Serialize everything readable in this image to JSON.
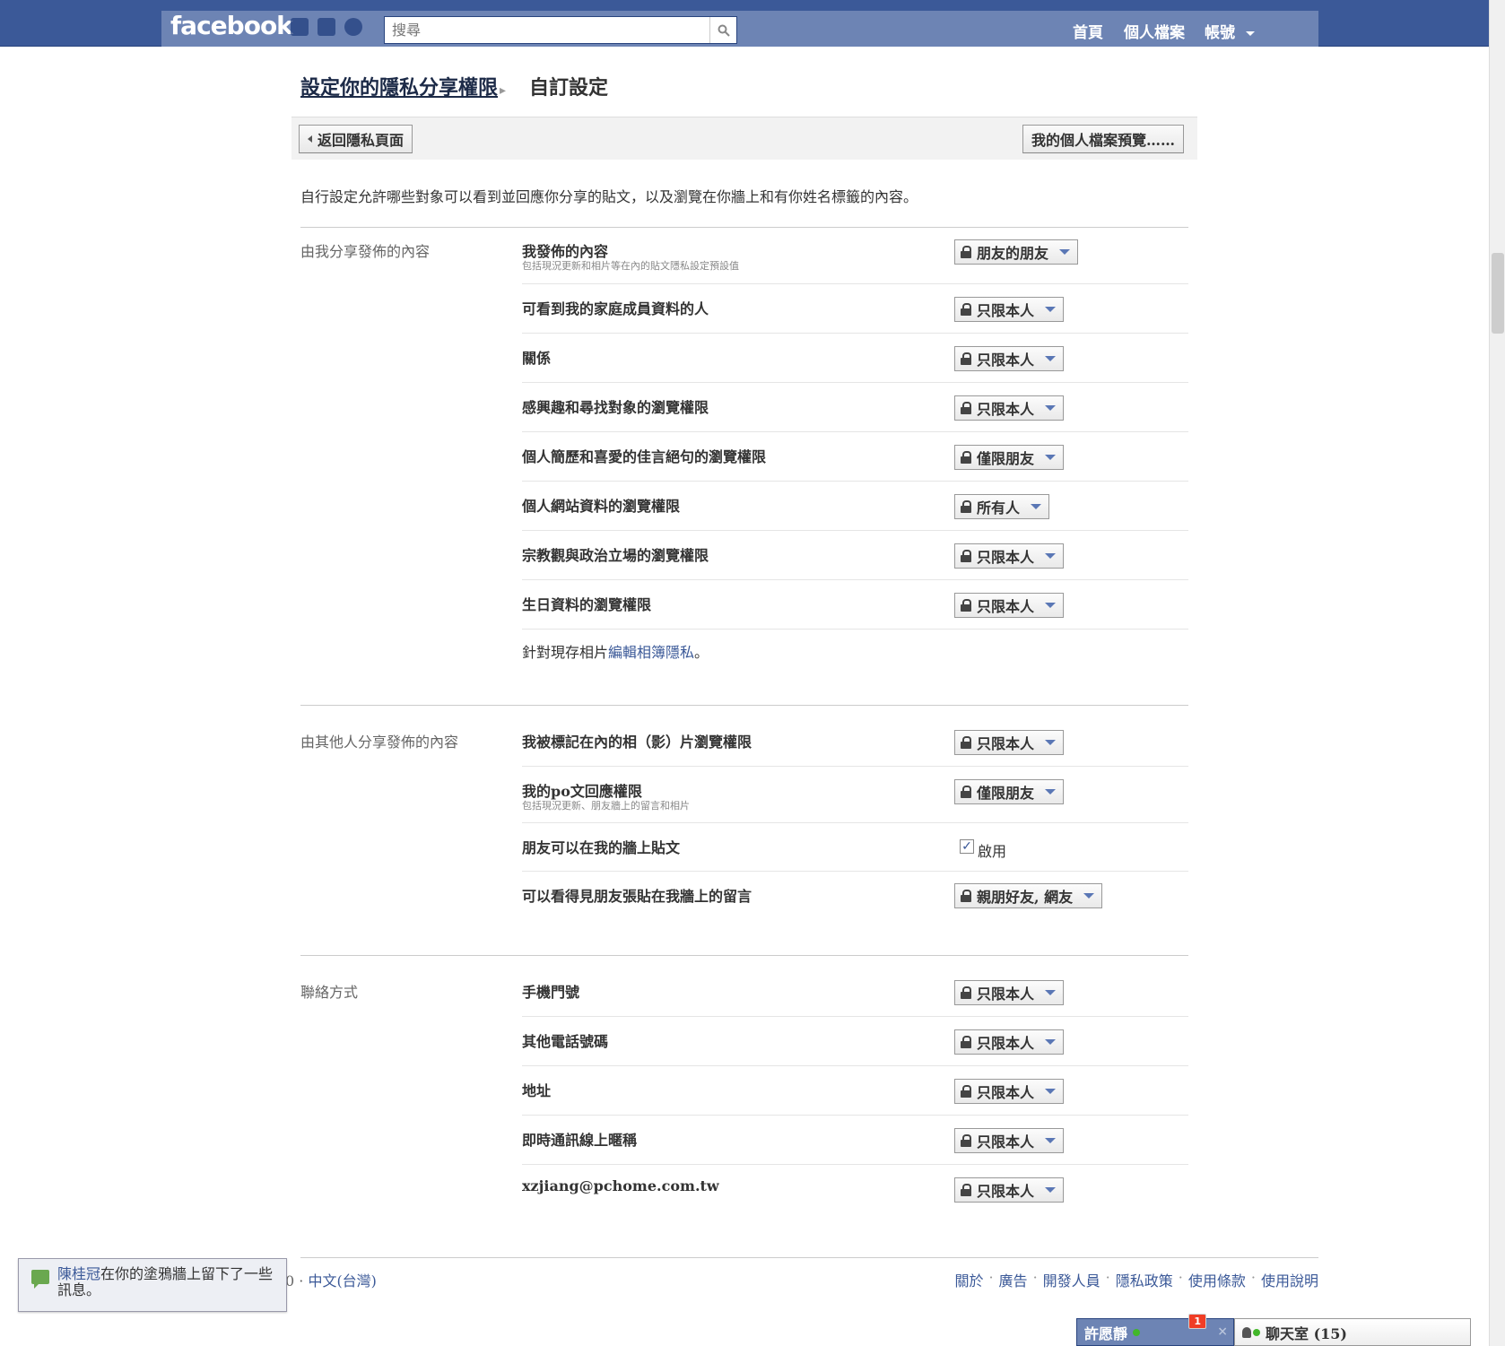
{
  "topbar": {
    "logo": "facebook",
    "search_placeholder": "搜尋",
    "nav": {
      "home": "首頁",
      "profile": "個人檔案",
      "account": "帳號"
    }
  },
  "header": {
    "breadcrumb_link": "設定你的隱私分享權限",
    "breadcrumb_current": "自訂設定"
  },
  "toolbar": {
    "back_label": "返回隱私頁面",
    "preview_label": "我的個人檔案預覽……"
  },
  "intro": "自行設定允許哪些對象可以看到並回應你分享的貼文，以及瀏覽在你牆上和有你姓名標籤的內容。",
  "sections": [
    {
      "title": "由我分享發佈的內容",
      "rows": [
        {
          "label": "我發佈的內容",
          "sub": "包括現況更新和相片等在內的貼文隱私設定預設值",
          "value": "朋友的朋友"
        },
        {
          "label": "可看到我的家庭成員資料的人",
          "value": "只限本人"
        },
        {
          "label": "關係",
          "value": "只限本人"
        },
        {
          "label": "感興趣和尋找對象的瀏覽權限",
          "value": "只限本人"
        },
        {
          "label": "個人簡歷和喜愛的佳言絕句的瀏覽權限",
          "value": "僅限朋友"
        },
        {
          "label": "個人網站資料的瀏覽權限",
          "value": "所有人"
        },
        {
          "label": "宗教觀與政治立場的瀏覽權限",
          "value": "只限本人"
        },
        {
          "label": "生日資料的瀏覽權限",
          "value": "只限本人"
        }
      ],
      "note_prefix": "針對現存相片",
      "note_link": "編輯相簿隱私",
      "note_suffix": "。"
    },
    {
      "title": "由其他人分享發佈的內容",
      "rows": [
        {
          "label": "我被標記在內的相（影）片瀏覽權限",
          "value": "只限本人"
        },
        {
          "label": "我的po文回應權限",
          "sub": "包括現況更新、朋友牆上的留言和相片",
          "value": "僅限朋友"
        },
        {
          "label": "朋友可以在我的牆上貼文",
          "checkbox_label": "啟用",
          "checked": true
        },
        {
          "label": "可以看得見朋友張貼在我牆上的留言",
          "value": "親朋好友, 網友"
        }
      ]
    },
    {
      "title": "聯絡方式",
      "rows": [
        {
          "label": "手機門號",
          "value": "只限本人"
        },
        {
          "label": "其他電話號碼",
          "value": "只限本人"
        },
        {
          "label": "地址",
          "value": "只限本人"
        },
        {
          "label": "即時通訊線上暱稱",
          "value": "只限本人"
        },
        {
          "label": "xzjiang@pchome.com.tw",
          "value": "只限本人"
        }
      ]
    }
  ],
  "footer": {
    "left_prefix": "0 · ",
    "language": "中文(台灣)",
    "links": [
      "關於",
      "廣告",
      "開發人員",
      "隱私政策",
      "使用條款",
      "使用說明"
    ]
  },
  "notification": {
    "name": "陳桂冠",
    "text": "在你的塗鴉牆上留下了一些訊息。"
  },
  "chat": {
    "user": "許愿靜",
    "badge": "1",
    "close": "×",
    "room": "聊天室 (15)"
  },
  "colors": {
    "brand": "#3b5998",
    "topbar_inner": "#6d84b4",
    "online": "#42b72a",
    "badge": "#f03d25"
  }
}
